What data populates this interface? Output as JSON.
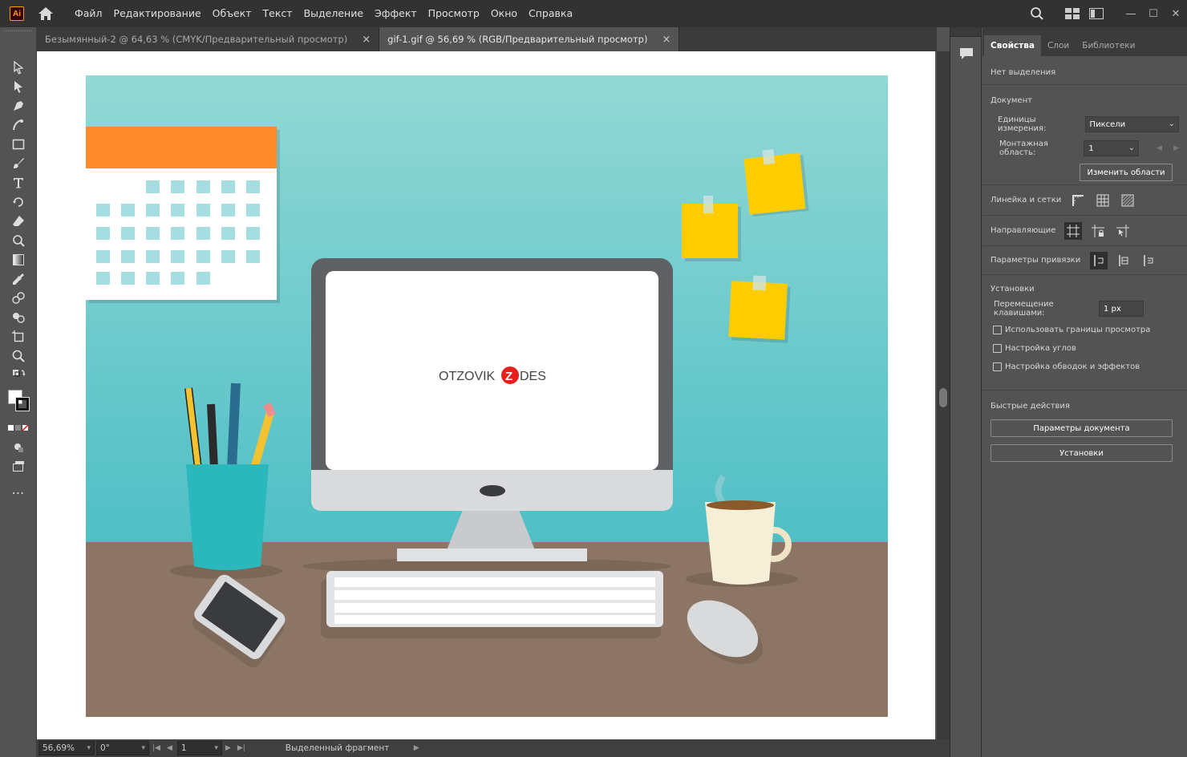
{
  "app": {
    "icon_text": "Ai"
  },
  "menu": [
    "Файл",
    "Редактирование",
    "Объект",
    "Текст",
    "Выделение",
    "Эффект",
    "Просмотр",
    "Окно",
    "Справка"
  ],
  "tabs": [
    {
      "label": "Безымянный-2 @ 64,63 % (CMYK/Предварительный просмотр)",
      "close": "×",
      "active": false
    },
    {
      "label": "gif-1.gif @ 56,69 % (RGB/Предварительный просмотр)",
      "close": "×",
      "active": true
    }
  ],
  "artwork": {
    "screen_text_left": "OTZOVIK",
    "screen_text_mid": "Z",
    "screen_text_right": "DES"
  },
  "status": {
    "zoom": "56,69%",
    "rotation": "0°",
    "artboard_num": "1",
    "status_text": "Выделенный фрагмент"
  },
  "panel": {
    "tabs": [
      "Свойства",
      "Слои",
      "Библиотеки"
    ],
    "no_selection": "Нет выделения",
    "document": {
      "title": "Документ",
      "units_label": "Единицы измерения:",
      "units_value": "Пиксели",
      "artboard_label": "Монтажная область:",
      "artboard_value": "1",
      "edit_artboards": "Изменить области"
    },
    "rulers_grids": "Линейка и сетки",
    "guides": "Направляющие",
    "snap_options": "Параметры привязки",
    "preferences": {
      "title": "Установки",
      "keyboard_increment_label": "Перемещение клавишами:",
      "keyboard_increment_value": "1 px",
      "checkbox_preview_bounds": "Использовать границы просмотра",
      "checkbox_scale_corners": "Настройка углов",
      "checkbox_scale_strokes": "Настройка обводок и эффектов"
    },
    "quick_actions": {
      "title": "Быстрые действия",
      "document_setup": "Параметры документа",
      "preferences": "Установки"
    }
  },
  "colors": {
    "accent_red": "#e8201b",
    "sky_top": "#8fd6d3",
    "sky_bottom": "#52c0c6",
    "desk": "#8c7565",
    "calendar_orange": "#ff8a2b",
    "sticky_yellow": "#ffcc00"
  }
}
